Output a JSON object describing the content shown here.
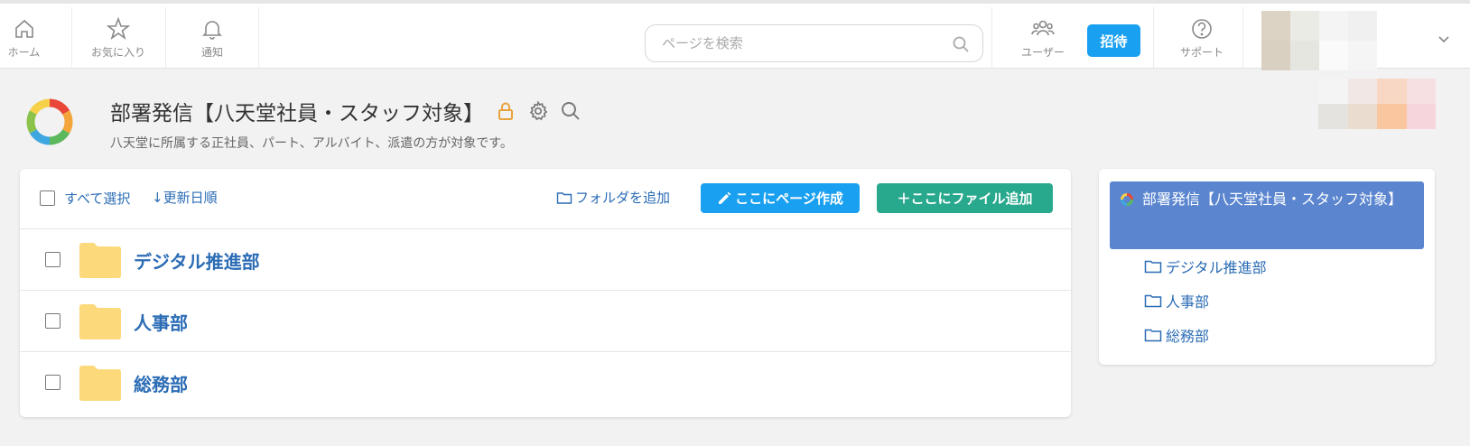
{
  "nav": {
    "home": "ホーム",
    "favorites": "お気に入り",
    "notifications": "通知",
    "users": "ユーザー",
    "invite": "招待",
    "support": "サポート"
  },
  "search": {
    "placeholder": "ページを検索"
  },
  "page": {
    "title": "部署発信【八天堂社員・スタッフ対象】",
    "description": "八天堂に所属する正社員、パート、アルバイト、派遣の方が対象です。"
  },
  "toolbar": {
    "select_all": "すべて選択",
    "sort": "↓更新日順",
    "add_folder": "フォルダを追加",
    "create_page": "ここにページ作成",
    "add_file": "＋ここにファイル追加"
  },
  "folders": [
    {
      "name": "デジタル推進部"
    },
    {
      "name": "人事部"
    },
    {
      "name": "総務部"
    }
  ],
  "tree": {
    "root": "部署発信【八天堂社員・スタッフ対象】",
    "items": [
      "デジタル推進部",
      "人事部",
      "総務部"
    ]
  },
  "colors": {
    "accent_blue": "#1aa0f0",
    "accent_green": "#28a88c",
    "link_blue": "#2b6cb5",
    "tree_selected": "#5b86cf",
    "folder_yellow": "#fcd97a",
    "lock_orange": "#e8a33c"
  },
  "icons": [
    "home-icon",
    "star-icon",
    "bell-icon",
    "users-icon",
    "help-icon",
    "search-icon",
    "lock-icon",
    "gear-icon",
    "pencil-icon",
    "folder-icon",
    "chevron-down-icon"
  ]
}
